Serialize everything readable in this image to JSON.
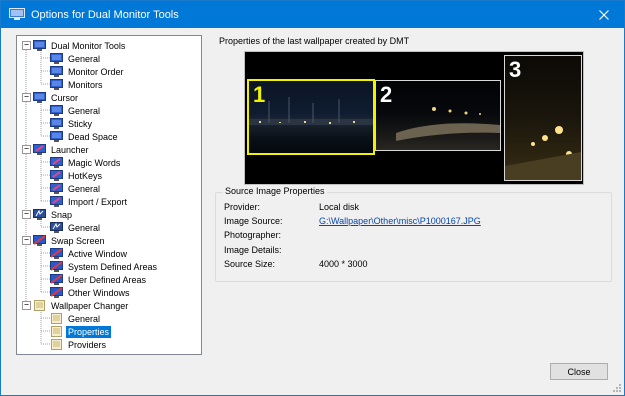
{
  "window": {
    "title": "Options for Dual Monitor Tools"
  },
  "tree": [
    {
      "id": "dmt",
      "label": "Dual Monitor Tools",
      "expanded": true,
      "icon": "dmt-monitor-icon",
      "children": [
        {
          "label": "General"
        },
        {
          "label": "Monitor Order"
        },
        {
          "label": "Monitors"
        }
      ]
    },
    {
      "id": "cursor",
      "label": "Cursor",
      "expanded": true,
      "icon": "cursor-icon",
      "children": [
        {
          "label": "General"
        },
        {
          "label": "Sticky"
        },
        {
          "label": "Dead Space"
        }
      ]
    },
    {
      "id": "launcher",
      "label": "Launcher",
      "expanded": true,
      "icon": "launcher-icon",
      "children": [
        {
          "label": "Magic Words"
        },
        {
          "label": "HotKeys"
        },
        {
          "label": "General"
        },
        {
          "label": "Import / Export"
        }
      ]
    },
    {
      "id": "snap",
      "label": "Snap",
      "expanded": true,
      "icon": "snap-icon",
      "children": [
        {
          "label": "General"
        }
      ]
    },
    {
      "id": "swap",
      "label": "Swap Screen",
      "expanded": true,
      "icon": "swap-screen-icon",
      "children": [
        {
          "label": "Active Window"
        },
        {
          "label": "System Defined Areas"
        },
        {
          "label": "User Defined Areas"
        },
        {
          "label": "Other Windows"
        }
      ]
    },
    {
      "id": "wallpaper",
      "label": "Wallpaper Changer",
      "expanded": true,
      "icon": "wallpaper-changer-icon",
      "children": [
        {
          "label": "General"
        },
        {
          "label": "Properties",
          "selected": true
        },
        {
          "label": "Providers"
        }
      ]
    }
  ],
  "panel": {
    "title": "Properties of the last wallpaper created by DMT",
    "monitors": [
      {
        "number": "1"
      },
      {
        "number": "2"
      },
      {
        "number": "3"
      }
    ],
    "group_title": "Source Image Properties",
    "props": [
      {
        "label": "Provider:",
        "value": "Local disk"
      },
      {
        "label": "Image Source:",
        "value": "G:\\Wallpaper\\Other\\misc\\P1000167.JPG",
        "link": true
      },
      {
        "label": "Photographer:",
        "value": ""
      },
      {
        "label": "Image Details:",
        "value": ""
      },
      {
        "label": "Source Size:",
        "value": "4000 * 3000"
      }
    ]
  },
  "buttons": {
    "close": "Close"
  },
  "colors": {
    "titlebar": "#0078d7",
    "selection": "#0078d7",
    "highlight_monitor": "#f2f200"
  }
}
